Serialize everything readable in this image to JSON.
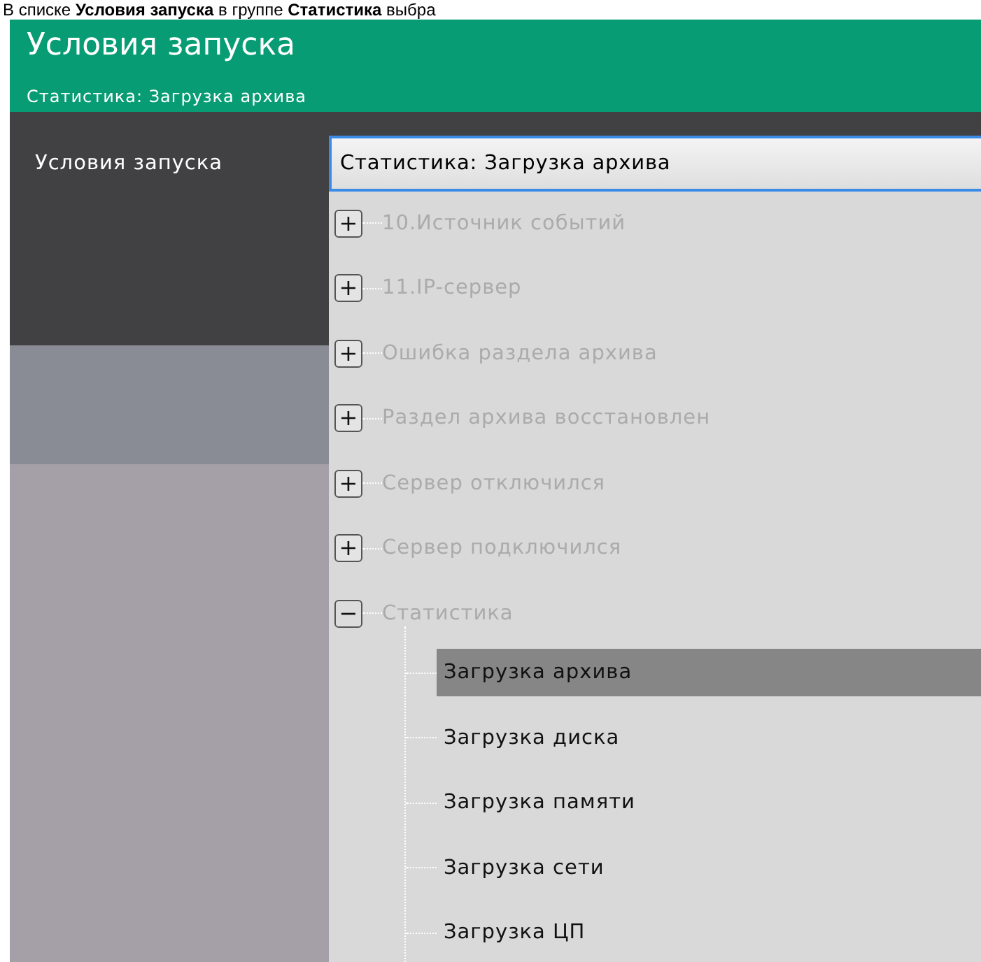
{
  "caption": "В списке **Условия запуска** в группе **Статистика** выбра",
  "dialog": {
    "title": "Условия запуска",
    "subtitle": "Статистика: Загрузка архива"
  },
  "form": {
    "label": "Условия запуска",
    "value": "Статистика: Загрузка архива"
  },
  "tree": [
    {
      "label": "10.Источник событий",
      "expanded": false,
      "disabled": true,
      "sign": "+"
    },
    {
      "label": "11.IP-сервер",
      "expanded": false,
      "disabled": true,
      "sign": "+"
    },
    {
      "label": "Ошибка раздела архива",
      "expanded": false,
      "disabled": true,
      "sign": "+"
    },
    {
      "label": "Раздел архива восстановлен",
      "expanded": false,
      "disabled": true,
      "sign": "+"
    },
    {
      "label": "Сервер отключился",
      "expanded": false,
      "disabled": true,
      "sign": "+"
    },
    {
      "label": "Сервер подключился",
      "expanded": false,
      "disabled": true,
      "sign": "+"
    },
    {
      "label": "Статистика",
      "expanded": true,
      "disabled": true,
      "sign": "−",
      "children": [
        {
          "label": "Загрузка архива",
          "selected": true,
          "disabled": false
        },
        {
          "label": "Загрузка диска",
          "selected": false,
          "disabled": false
        },
        {
          "label": "Загрузка памяти",
          "selected": false,
          "disabled": false
        },
        {
          "label": "Загрузка сети",
          "selected": false,
          "disabled": false
        },
        {
          "label": "Загрузка ЦП",
          "selected": false,
          "disabled": false
        }
      ]
    }
  ]
}
